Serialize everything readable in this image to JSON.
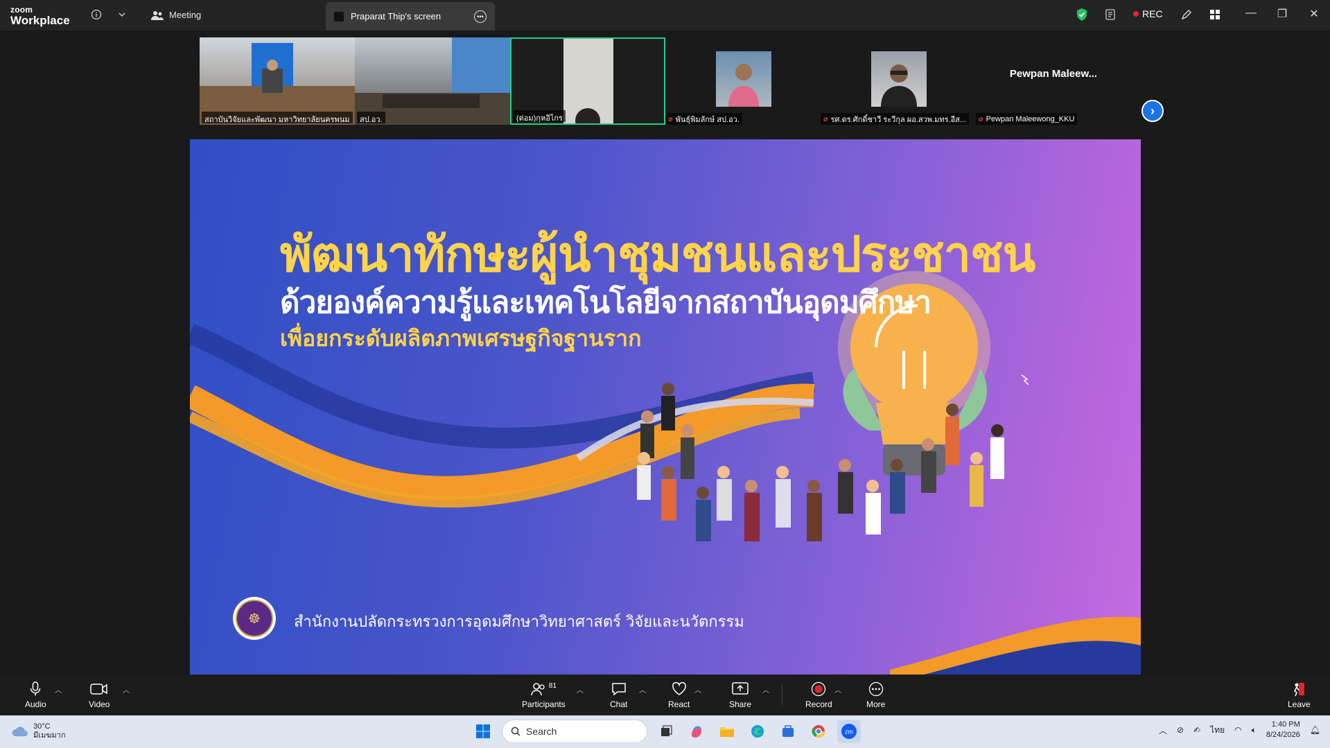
{
  "titlebar": {
    "logo_top": "zoom",
    "logo_bottom": "Workplace",
    "meeting_label": "Meeting",
    "screen_tab": "Praparat Thip's screen",
    "rec_label": "REC"
  },
  "participants_strip": {
    "tiles": [
      {
        "name": "สถาบันวิจัยและพัฒนา มหาวิทยาลัยนครพนม"
      },
      {
        "name": "สป.อว."
      },
      {
        "name": "(ต่อม)กุหอิไกร"
      },
      {
        "name": "พันธุ์พิมลักษ์ สป.อว."
      },
      {
        "name": "รศ.ดร.ศักดิ์ชาวี ระวีกุล ผอ.สวพ.มทร.อีส..."
      },
      {
        "name": "Pewpan Maleewong_KKU",
        "display": "Pewpan  Maleew..."
      }
    ]
  },
  "slide": {
    "title": "พัฒนาทักษะผู้นำชุมชนและประชาชน",
    "subtitle": "ด้วยองค์ความรู้และเทคโนโลยีจากสถาบันอุดมศึกษา",
    "tagline": "เพื่อยกระดับผลิตภาพเศรษฐกิจฐานราก",
    "footer": "สำนักงานปลัดกระทรวงการอุดมศึกษาวิทยาศาสตร์ วิจัยและนวัตกรรม"
  },
  "controls": {
    "audio": "Audio",
    "video": "Video",
    "participants": "Participants",
    "participants_count": "81",
    "chat": "Chat",
    "react": "React",
    "share": "Share",
    "record": "Record",
    "more": "More",
    "leave": "Leave"
  },
  "taskbar": {
    "temp": "30°C",
    "weather": "มีเมฆมาก",
    "search_placeholder": "Search",
    "lang": "ไทย",
    "time": "1:40 PM",
    "date": "8/24/2026"
  },
  "colors": {
    "accent_yellow": "#ffd44a",
    "zoom_blue": "#0b5cff",
    "rec_red": "#e02828",
    "active_speaker": "#23d18b"
  }
}
